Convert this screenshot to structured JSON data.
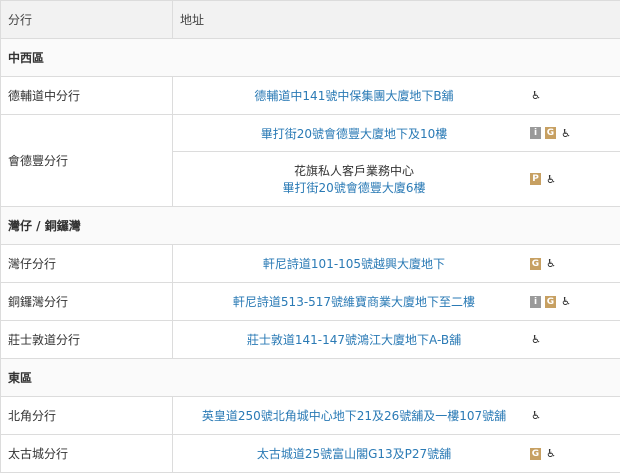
{
  "header": {
    "col_branch": "分行",
    "col_address": "地址"
  },
  "sections": [
    {
      "title": "中西區",
      "branches": [
        {
          "name": "德輔道中分行",
          "rows": [
            {
              "lines": [
                {
                  "text": "德輔道中141號中保集團大廈地下B舖",
                  "link": true
                }
              ],
              "icons": [
                "wheelchair-icon"
              ]
            }
          ]
        },
        {
          "name": "會德豐分行",
          "rows": [
            {
              "lines": [
                {
                  "text": "畢打街20號會德豐大廈地下及10樓",
                  "link": true
                }
              ],
              "icons": [
                "i-icon",
                "g-icon",
                "wheelchair-icon"
              ]
            },
            {
              "lines": [
                {
                  "text": "花旗私人客戶業務中心",
                  "link": false
                },
                {
                  "text": "畢打街20號會德豐大廈6樓",
                  "link": true
                }
              ],
              "icons": [
                "p-icon",
                "wheelchair-icon"
              ]
            }
          ]
        }
      ]
    },
    {
      "title": "灣仔 / 銅鑼灣",
      "branches": [
        {
          "name": "灣仔分行",
          "rows": [
            {
              "lines": [
                {
                  "text": "軒尼詩道101-105號越興大廈地下",
                  "link": true
                }
              ],
              "icons": [
                "g-icon",
                "wheelchair-icon"
              ]
            }
          ]
        },
        {
          "name": "銅鑼灣分行",
          "rows": [
            {
              "lines": [
                {
                  "text": "軒尼詩道513-517號維寶商業大廈地下至二樓",
                  "link": true
                }
              ],
              "icons": [
                "i-icon",
                "g-icon",
                "wheelchair-icon"
              ]
            }
          ]
        },
        {
          "name": "莊士敦道分行",
          "rows": [
            {
              "lines": [
                {
                  "text": "莊士敦道141-147號鴻江大廈地下A-B舖",
                  "link": true
                }
              ],
              "icons": [
                "wheelchair-icon"
              ]
            }
          ]
        }
      ]
    },
    {
      "title": "東區",
      "branches": [
        {
          "name": "北角分行",
          "rows": [
            {
              "lines": [
                {
                  "text": "英皇道250號北角城中心地下21及26號舖及一樓107號舖",
                  "link": true
                }
              ],
              "icons": [
                "wheelchair-icon"
              ]
            }
          ]
        },
        {
          "name": "太古城分行",
          "rows": [
            {
              "lines": [
                {
                  "text": "太古城道25號富山閣G13及P27號舖",
                  "link": true
                }
              ],
              "icons": [
                "g-icon",
                "wheelchair-icon"
              ]
            }
          ]
        }
      ]
    }
  ],
  "icon_glyphs": {
    "i-icon": "i",
    "g-icon": "G",
    "p-icon": "P",
    "wheelchair-icon": "♿"
  },
  "colors": {
    "link": "#2a7ab5",
    "badge_gray": "#9a9a9a",
    "badge_gold": "#c7a062",
    "border": "#dcdcdc",
    "header_bg": "#f2f2f2"
  }
}
